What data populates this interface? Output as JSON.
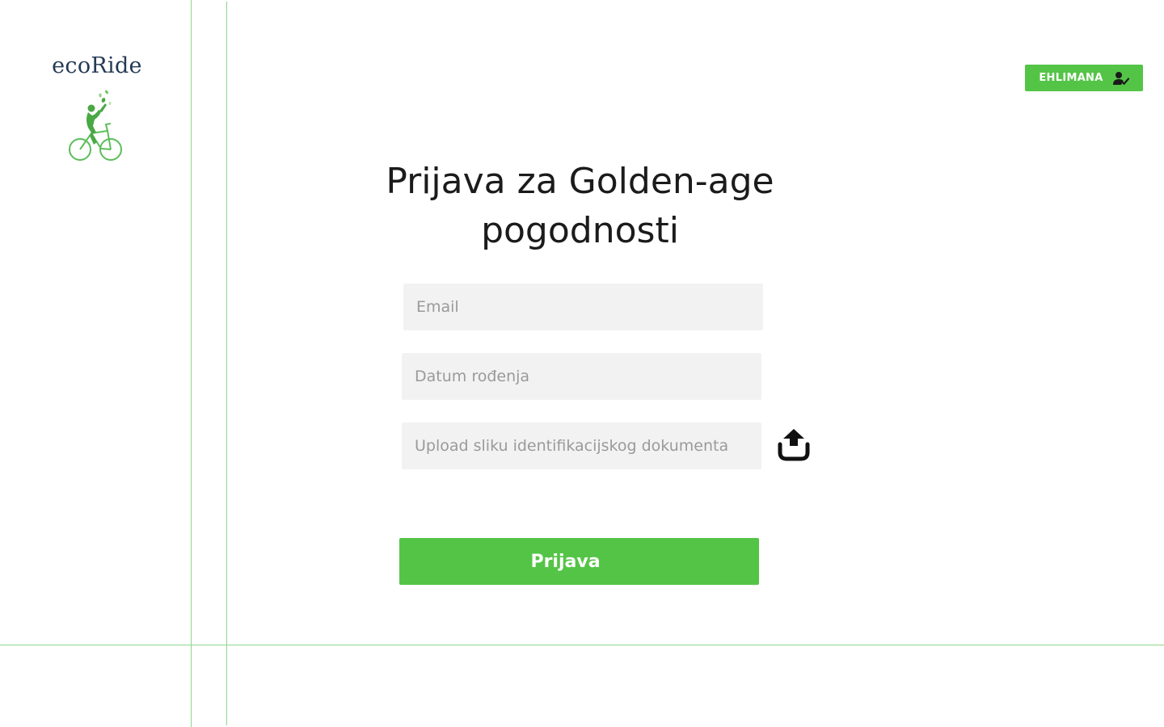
{
  "brand": {
    "name": "ecoRide",
    "logo_icon": "cyclist-logo-icon",
    "accent_color": "#54c447",
    "name_color": "#243a55"
  },
  "header": {
    "user_button_label": "EHLIMANA",
    "user_button_icon": "user-check-icon"
  },
  "main": {
    "title": "Prijava za Golden-age pogodnosti",
    "fields": {
      "email_placeholder": "Email",
      "dob_placeholder": "Datum rođenja",
      "upload_placeholder": "Upload sliku identifikacijskog dokumenta"
    },
    "upload_icon": "upload-icon",
    "submit_label": "Prijava"
  }
}
